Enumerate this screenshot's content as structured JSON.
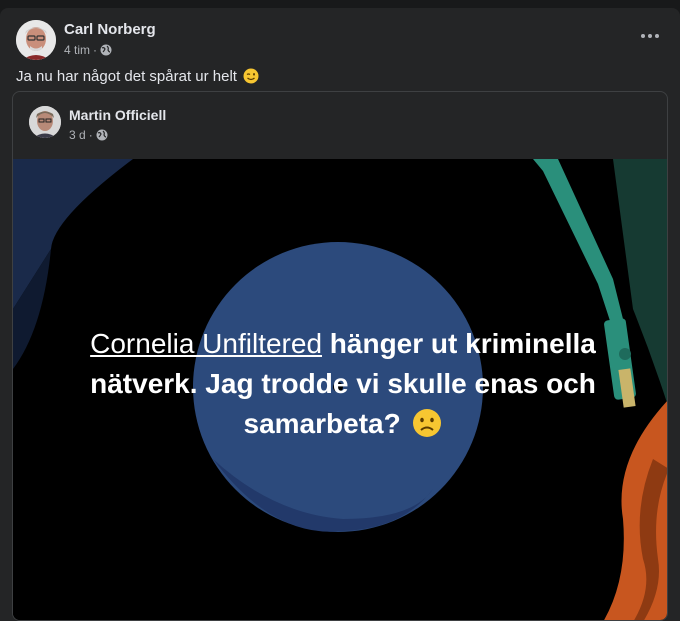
{
  "post": {
    "author": "Carl Norberg",
    "time": "4 tim",
    "separator": "·",
    "text": "Ja nu har något det spårat ur helt",
    "text_emoji": "wink-emoji"
  },
  "shared_post": {
    "author": "Martin Officiell",
    "time": "3 d",
    "separator": "·",
    "caption_link": "Cornelia Unfiltered",
    "caption_rest": " hänger ut kriminella nätverk. Jag trodde vi skulle enas och samarbeta?",
    "caption_emoji": "frowning-emoji"
  },
  "colors": {
    "background": "#18191a",
    "card": "#242526",
    "text_primary": "#e4e6eb",
    "text_secondary": "#b0b3b8",
    "record_label": "#2c4a7c",
    "tonearm": "#2a8f7b",
    "accent_orange": "#c8561f"
  }
}
